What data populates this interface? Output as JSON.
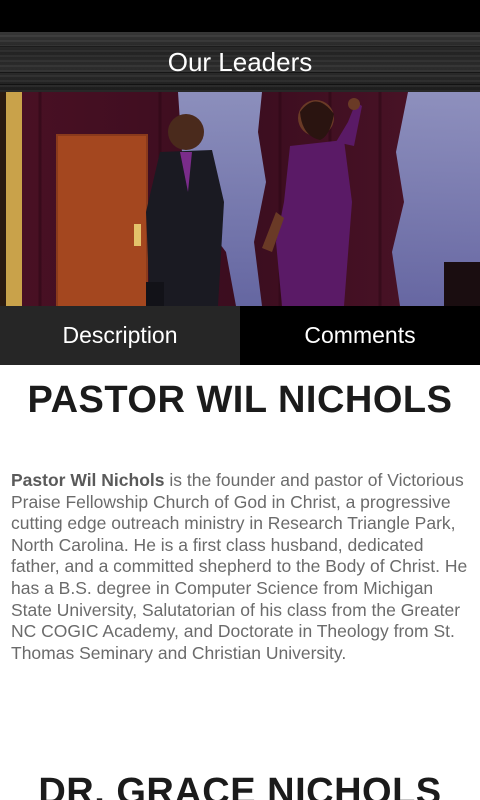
{
  "app": {
    "title": "Our Leaders"
  },
  "hero": {
    "image": "leaders-photo"
  },
  "tabs": [
    {
      "label": "Description",
      "active": true
    },
    {
      "label": "Comments",
      "active": false
    }
  ],
  "leaders": [
    {
      "name": "PASTOR WIL NICHOLS",
      "bio_name": "Pastor Wil Nichols",
      "bio_rest": " is the founder and pastor of Victorious Praise Fellowship Church of God in Christ, a progressive cutting edge outreach ministry in Research Triangle Park, North Carolina. He is a first class husband, dedicated father, and a committed shepherd to the Body of Christ. He has a B.S. degree in Computer Science from Michigan State University, Salutatorian of his class from the Greater NC COGIC Academy, and Doctorate in Theology from St. Thomas Seminary and Christian University."
    },
    {
      "name": "DR. GRACE NICHOLS"
    }
  ],
  "colors": {
    "header": "#2b2b2b",
    "tab_active": "#262626",
    "tab_inactive": "#000000",
    "text": "#1b1b1b",
    "bio": "#6b6b6b"
  }
}
